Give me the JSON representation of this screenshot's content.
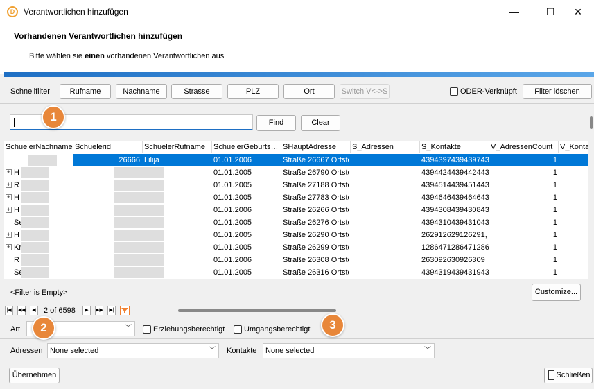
{
  "window": {
    "title": "Verantwortlichen hinzufügen",
    "minimize": "—",
    "maximize": "☐",
    "close": "✕"
  },
  "header": {
    "title": "Vorhandenen Verantwortlichen hinzufügen",
    "subtitle_pre": "Bitte wählen sie ",
    "subtitle_bold": "einen",
    "subtitle_post": " vorhandenen Verantwortlichen aus"
  },
  "schnellfilter": {
    "label": "Schnellfilter",
    "buttons": [
      "Rufname",
      "Nachname",
      "Strasse",
      "PLZ",
      "Ort"
    ],
    "switch_label": "Switch V<->S",
    "oder_label": "ODER-Verknüpft",
    "clear_label": "Filter löschen"
  },
  "search": {
    "value": "",
    "find_label": "Find",
    "clear_label": "Clear"
  },
  "grid": {
    "columns": [
      "SchuelerNachname",
      "Schuelerid",
      "SchuelerRufname",
      "SchuelerGeburts…",
      "SHauptAdresse",
      "S_Adressen",
      "S_Kontakte",
      "V_AdressenCount",
      "V_Konta"
    ],
    "rows": [
      {
        "name": "",
        "id": "26666",
        "ruf": "Lilija",
        "geb": "01.01.2006",
        "adr": "Straße 26667 Ortste",
        "sadr": "",
        "kont": "4394397439439743",
        "cnt": "1",
        "exp": false,
        "sel": true
      },
      {
        "name": "H",
        "id": "",
        "ruf": "",
        "geb": "01.01.2005",
        "adr": "Straße 26790 Ortste",
        "sadr": "",
        "kont": "4394424439442443",
        "cnt": "1",
        "exp": true,
        "sel": false
      },
      {
        "name": "R",
        "id": "",
        "ruf": "",
        "geb": "01.01.2005",
        "adr": "Straße 27188 Ortste",
        "sadr": "",
        "kont": "4394514439451443",
        "cnt": "1",
        "exp": true,
        "sel": false
      },
      {
        "name": "H",
        "id": "",
        "ruf": "",
        "geb": "01.01.2005",
        "adr": "Straße 27783 Ortste",
        "sadr": "",
        "kont": "4394646439464643",
        "cnt": "1",
        "exp": true,
        "sel": false
      },
      {
        "name": "H",
        "id": "",
        "ruf": "",
        "geb": "01.01.2006",
        "adr": "Straße 26266 Ortste",
        "sadr": "",
        "kont": "4394308439430843",
        "cnt": "1",
        "exp": true,
        "sel": false
      },
      {
        "name": "Se",
        "id": "",
        "ruf": "",
        "geb": "01.01.2005",
        "adr": "Straße 26276 Ortste",
        "sadr": "",
        "kont": "4394310439431043",
        "cnt": "1",
        "exp": false,
        "sel": false
      },
      {
        "name": "H",
        "id": "",
        "ruf": "",
        "geb": "01.01.2005",
        "adr": "Straße 26290 Ortste",
        "sadr": "",
        "kont": "262912629126291,",
        "cnt": "1",
        "exp": true,
        "sel": false
      },
      {
        "name": "Kr",
        "id": "",
        "ruf": "",
        "geb": "01.01.2005",
        "adr": "Straße 26299 Ortste",
        "sadr": "",
        "kont": "1286471286471286",
        "cnt": "1",
        "exp": true,
        "sel": false
      },
      {
        "name": "R",
        "id": "",
        "ruf": "",
        "geb": "01.01.2006",
        "adr": "Straße 26308 Ortste",
        "sadr": "",
        "kont": "263092630926309",
        "cnt": "1",
        "exp": false,
        "sel": false
      },
      {
        "name": "Se",
        "id": "",
        "ruf": "",
        "geb": "01.01.2005",
        "adr": "Straße 26316 Ortste",
        "sadr": "",
        "kont": "4394319439431943",
        "cnt": "1",
        "exp": false,
        "sel": false
      }
    ],
    "filter_status": "<Filter is Empty>",
    "customize_label": "Customize...",
    "pager_text": "2 of 6598"
  },
  "filters": {
    "art_label": "Art",
    "art_value": "",
    "erziehung_label": "Erziehungsberechtigt",
    "umgang_label": "Umgangsberechtigt",
    "adressen_label": "Adressen",
    "adressen_value": "None selected",
    "kontakte_label": "Kontakte",
    "kontakte_value": "None selected"
  },
  "footer": {
    "uebernehmen_label": "Übernehmen",
    "schliessen_label": "Schließen"
  },
  "badges": [
    "1",
    "2",
    "3"
  ],
  "colors": {
    "accent": "#1e6fc4",
    "selection": "#0078d7",
    "badge": "#e8873a"
  }
}
